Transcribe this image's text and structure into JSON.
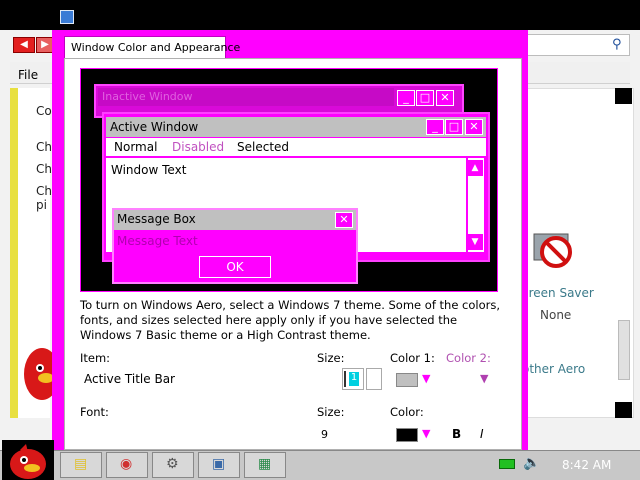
{
  "background_window": {
    "menu_file": "File",
    "left_snippets": [
      "Co",
      "Ch",
      "Ch",
      "Ch",
      "pi"
    ],
    "screen_saver_label": "creen Saver",
    "screen_saver_value": "None",
    "other_aero": "other Aero"
  },
  "dialog": {
    "tab_label": "Window Color and Appearance",
    "preview": {
      "inactive_window_title": "Inactive Window",
      "active_window_title": "Active Window",
      "menu_normal": "Normal",
      "menu_disabled": "Disabled",
      "menu_selected": "Selected",
      "window_text": "Window Text",
      "message_box_title": "Message Box",
      "message_text": "Message Text",
      "ok_label": "OK"
    },
    "description": "To turn on Windows Aero, select a Windows 7 theme.  Some of the colors, fonts, and sizes selected here apply only if you have selected the Windows 7 Basic theme or a High Contrast theme.",
    "item_label": "Item:",
    "item_value": "Active Title Bar",
    "size_label": "Size:",
    "size_value": "1",
    "color1_label": "Color 1:",
    "color2_label": "Color 2:",
    "color1_value": "#c0c0c0",
    "font_label": "Font:",
    "font_size_label": "Size:",
    "font_size_value": "9",
    "font_color_label": "Color:",
    "font_color_value": "#000000",
    "bold_label": "B",
    "italic_label": "I"
  },
  "taskbar": {
    "buttons": [
      "explorer-icon",
      "chrome-icon",
      "tools-icon",
      "window-icon",
      "display-icon"
    ],
    "clock": "8:42 AM"
  },
  "colors": {
    "accent": "#ff00ff",
    "title_bar": "#c0c0c0"
  }
}
